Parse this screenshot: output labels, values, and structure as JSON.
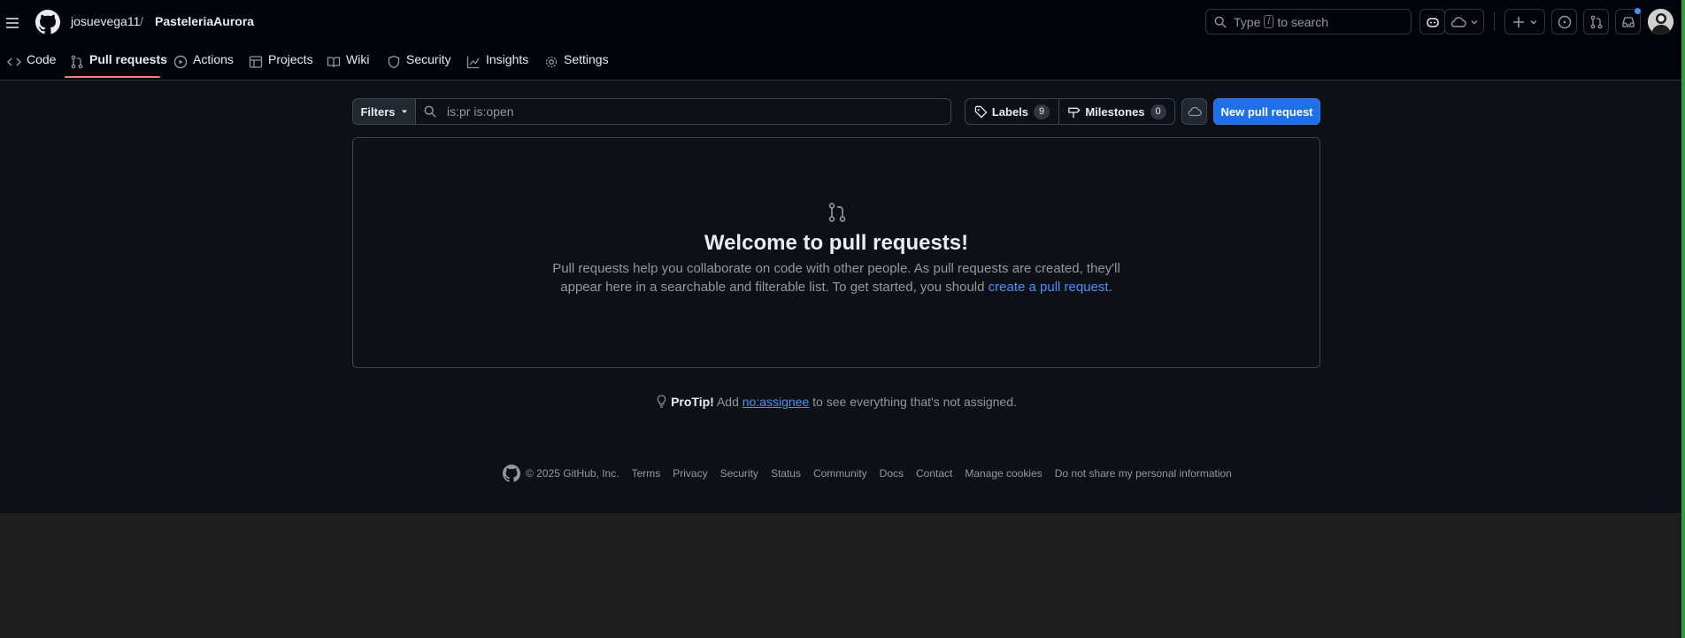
{
  "header": {
    "owner": "josuevega11",
    "separator": "/",
    "repo": "PasteleriaAurora",
    "search": {
      "prefix": "Type",
      "key": "/",
      "suffix": "to search"
    }
  },
  "tabs": [
    {
      "label": "Code",
      "icon": "code-icon"
    },
    {
      "label": "Pull requests",
      "icon": "git-pull-request-icon",
      "active": true
    },
    {
      "label": "Actions",
      "icon": "play-icon"
    },
    {
      "label": "Projects",
      "icon": "table-icon"
    },
    {
      "label": "Wiki",
      "icon": "book-icon"
    },
    {
      "label": "Security",
      "icon": "shield-icon"
    },
    {
      "label": "Insights",
      "icon": "graph-icon"
    },
    {
      "label": "Settings",
      "icon": "gear-icon"
    }
  ],
  "subnav": {
    "filters_label": "Filters",
    "filter_value": "is:pr is:open",
    "labels_label": "Labels",
    "labels_count": "9",
    "milestones_label": "Milestones",
    "milestones_count": "0",
    "new_pr_label": "New pull request"
  },
  "blankslate": {
    "title": "Welcome to pull requests!",
    "line1": "Pull requests help you collaborate on code with other people. As pull requests are created, they'll",
    "line2_prefix": "appear here in a searchable and filterable list. To get started, you should ",
    "line2_link": "create a pull request",
    "line2_suffix": "."
  },
  "protip": {
    "label": "ProTip!",
    "prefix": " Add ",
    "link": "no:assignee",
    "suffix": " to see everything that's not assigned."
  },
  "footer": {
    "copyright": "© 2025 GitHub, Inc.",
    "links": [
      "Terms",
      "Privacy",
      "Security",
      "Status",
      "Community",
      "Docs",
      "Contact",
      "Manage cookies",
      "Do not share my personal information"
    ]
  },
  "colors": {
    "background": "#0d1117",
    "header_bg": "#010409",
    "accent_blue": "#1f6feb",
    "tab_underline": "#f78166",
    "link": "#4493f8"
  }
}
